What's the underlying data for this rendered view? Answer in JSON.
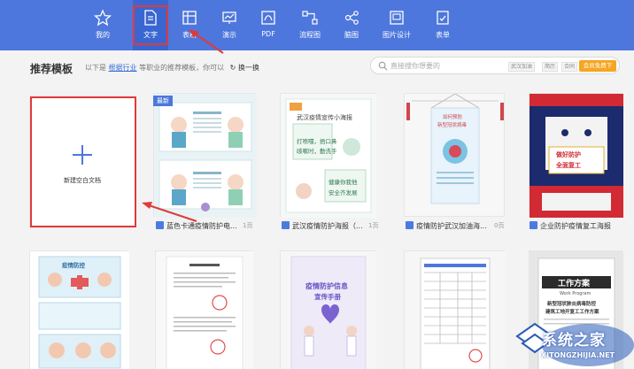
{
  "toolbar": {
    "items": [
      {
        "label": "我的",
        "icon": "star-icon"
      },
      {
        "label": "文字",
        "icon": "document-icon"
      },
      {
        "label": "表格",
        "icon": "table-icon"
      },
      {
        "label": "演示",
        "icon": "presentation-icon"
      },
      {
        "label": "PDF",
        "icon": "pdf-icon"
      },
      {
        "label": "流程图",
        "icon": "flowchart-icon"
      },
      {
        "label": "脑图",
        "icon": "mindmap-icon"
      },
      {
        "label": "图片设计",
        "icon": "image-design-icon"
      },
      {
        "label": "表单",
        "icon": "form-icon"
      }
    ],
    "active": "文字"
  },
  "header": {
    "title": "推荐模板",
    "subtitle_prefix": "以下是",
    "subtitle_link": "根据行业",
    "subtitle_suffix": "等职业的推荐模板，你可以",
    "swap_label": "换一换"
  },
  "search": {
    "placeholder": "直接搜你想要的",
    "tags": [
      "武汉加油",
      "简历",
      "合同"
    ],
    "vip_label": "会员免费下"
  },
  "new_doc": {
    "label": "新建空白文档"
  },
  "badge_new": "最新",
  "templates_row1": [
    {
      "title": "蓝色卡通疫情防护电...",
      "pages": "1页"
    },
    {
      "title": "武汉疫情防护海报（...",
      "pages": "1页"
    },
    {
      "title": "疫情防护武汉加油海...",
      "pages": "0页"
    },
    {
      "title": "企业防护疫情复工海报",
      "pages": ""
    }
  ],
  "thumb_texts": {
    "wuhan_poster_title": "武汉疫情宣传小海报",
    "wuhan_line1": "打喷嚏，捂口鼻",
    "wuhan_line2": "咳嗽时，勤洗手",
    "wuhan_line3": "健康你我他",
    "wuhan_line4": "安全齐发展",
    "flag_title1": "如何预防",
    "flag_title2": "新型冠状病毒",
    "mask_text1": "做好防护",
    "mask_text2": "全面复工",
    "cartoon_title": "疫情防控",
    "brochure_title1": "疫情防护信息",
    "brochure_title2": "宣传手册",
    "work_plan_title": "工作方案",
    "work_plan_en": "Work Program",
    "work_plan_desc1": "新型冠状肺炎病毒防控",
    "work_plan_desc2": "建筑工地开复工工作方案"
  },
  "watermark": {
    "text": "系统之家",
    "sub": "XITONGZHIJIA.NET"
  }
}
